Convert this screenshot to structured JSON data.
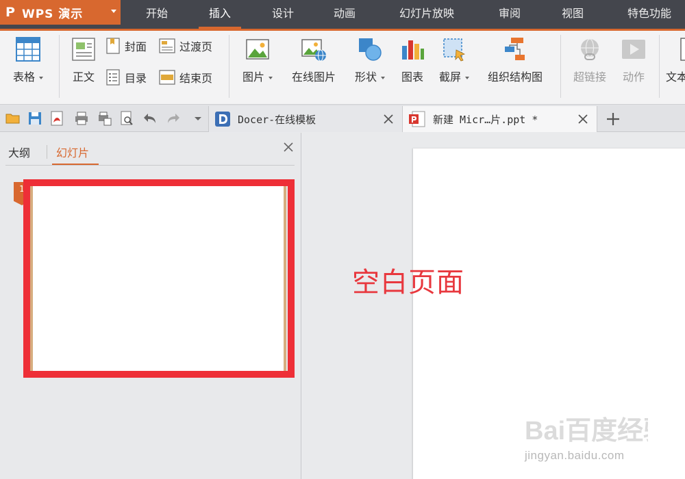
{
  "app": {
    "logo": "P",
    "title": "WPS 演示"
  },
  "menu": [
    "开始",
    "插入",
    "设计",
    "动画",
    "幻灯片放映",
    "审阅",
    "视图",
    "特色功能"
  ],
  "menu_active": "插入",
  "ribbon": {
    "table": "表格",
    "body_text": "正文",
    "cover": "封面",
    "toc": "目录",
    "transition_page": "过渡页",
    "end_page": "结束页",
    "picture": "图片",
    "online_picture": "在线图片",
    "shape": "形状",
    "chart": "图表",
    "screenshot": "截屏",
    "org_chart": "组织结构图",
    "hyperlink": "超链接",
    "action": "动作",
    "textbox_partial": "文本"
  },
  "tabs": {
    "docer": "Docer-在线模板",
    "current": "新建 Micr…片.ppt *"
  },
  "panel": {
    "outline_tab": "大纲",
    "slides_tab": "幻灯片",
    "slide_number": "1"
  },
  "annotation": "空白页面",
  "watermark": {
    "brand": "Bai百度经验",
    "url": "jingyan.baidu.com"
  },
  "colors": {
    "accent": "#d8682f",
    "menubar": "#44464d",
    "highlight_red": "#ee2f37"
  }
}
